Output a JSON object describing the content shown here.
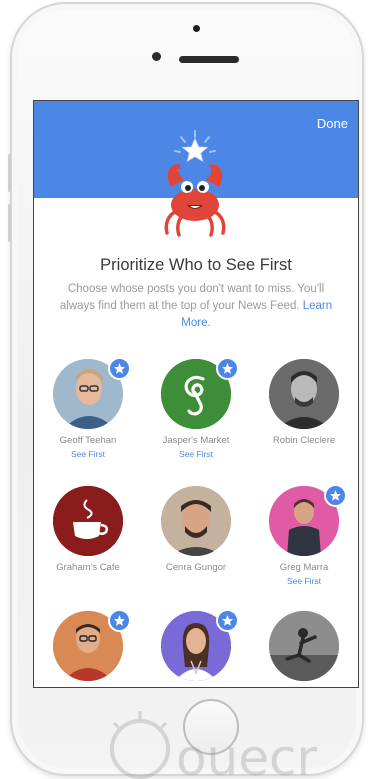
{
  "header": {
    "done_label": "Done"
  },
  "main": {
    "title": "Prioritize Who to See First",
    "description": "Choose whose posts you don't want to miss. You'll always find them at the top of your News Feed.",
    "learn_more": "Learn More."
  },
  "people": [
    {
      "name": "Geoff Teehan",
      "see_first": "See First",
      "selected": true,
      "avatar": "portrait-man-glasses"
    },
    {
      "name": "Jasper's Market",
      "see_first": "See First",
      "selected": true,
      "avatar": "green-logo-g"
    },
    {
      "name": "Robin Cleclere",
      "see_first": "",
      "selected": false,
      "avatar": "portrait-man-bw"
    },
    {
      "name": "Graham's Cafe",
      "see_first": "",
      "selected": false,
      "avatar": "maroon-coffee-logo"
    },
    {
      "name": "Cenra Gungor",
      "see_first": "",
      "selected": false,
      "avatar": "portrait-man-cap"
    },
    {
      "name": "Greg Marra",
      "see_first": "See First",
      "selected": true,
      "avatar": "portrait-man-pink"
    },
    {
      "name": "",
      "see_first": "",
      "selected": true,
      "avatar": "portrait-man-orange"
    },
    {
      "name": "",
      "see_first": "",
      "selected": true,
      "avatar": "portrait-woman"
    },
    {
      "name": "",
      "see_first": "",
      "selected": false,
      "avatar": "portrait-dancer"
    }
  ],
  "colors": {
    "accent": "#4d87e6",
    "crab": "#e0453a"
  }
}
